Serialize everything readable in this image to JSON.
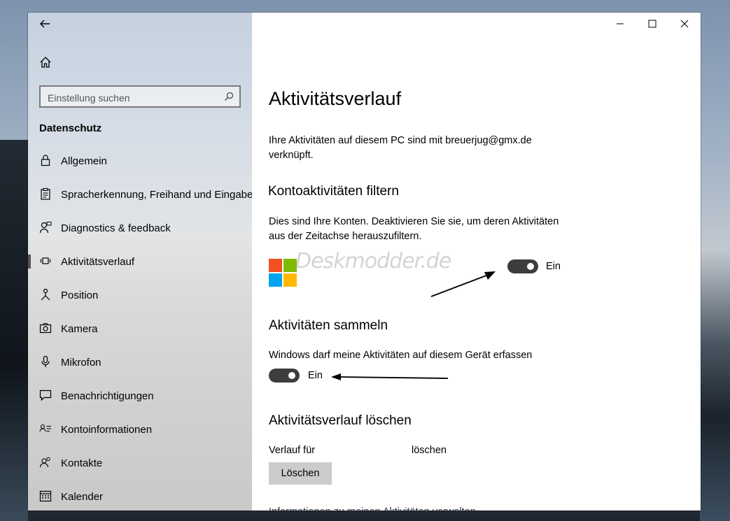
{
  "window": {
    "back_icon": "back-arrow-icon",
    "home_icon": "home-icon",
    "minimize_icon": "minimize-icon",
    "maximize_icon": "maximize-icon",
    "close_icon": "close-icon"
  },
  "sidebar": {
    "search_placeholder": "Einstellung suchen",
    "section_title": "Datenschutz",
    "items": [
      {
        "label": "Allgemein",
        "icon": "lock-icon"
      },
      {
        "label": "Spracherkennung, Freihand und Eingabe",
        "icon": "clipboard-icon"
      },
      {
        "label": "Diagnostics & feedback",
        "icon": "person-feedback-icon"
      },
      {
        "label": "Aktivitätsverlauf",
        "icon": "timeline-icon",
        "active": true
      },
      {
        "label": "Position",
        "icon": "location-icon"
      },
      {
        "label": "Kamera",
        "icon": "camera-icon"
      },
      {
        "label": "Mikrofon",
        "icon": "microphone-icon"
      },
      {
        "label": "Benachrichtigungen",
        "icon": "notification-icon"
      },
      {
        "label": "Kontoinformationen",
        "icon": "account-info-icon"
      },
      {
        "label": "Kontakte",
        "icon": "contacts-icon"
      },
      {
        "label": "Kalender",
        "icon": "calendar-icon"
      }
    ]
  },
  "main": {
    "title": "Aktivitätsverlauf",
    "intro_line1": "Ihre Aktivitäten auf diesem PC sind mit  breuerjug@gmx.de",
    "intro_line2": "verknüpft.",
    "filter_heading": "Kontoaktivitäten filtern",
    "filter_desc_line1": "Dies sind Ihre Konten. Deaktivieren Sie sie, um deren Aktivitäten",
    "filter_desc_line2": "aus der Zeitachse herauszufiltern.",
    "watermark": "Deskmodder.de",
    "account_toggle_label": "Ein",
    "collect_heading": "Aktivitäten sammeln",
    "collect_desc": "Windows darf meine Aktivitäten auf diesem Gerät erfassen",
    "collect_toggle_label": "Ein",
    "delete_heading": "Aktivitätsverlauf löschen",
    "delete_desc_prefix": "Verlauf für",
    "delete_desc_suffix": "löschen",
    "delete_button": "Löschen",
    "manage_link": "Informationen zu meinen Aktivitäten verwalten"
  },
  "colors": {
    "toggle_on": "#3d3d3d",
    "ms_red": "#f25022",
    "ms_green": "#7fba00",
    "ms_blue": "#00a4ef",
    "ms_yellow": "#ffb900"
  }
}
